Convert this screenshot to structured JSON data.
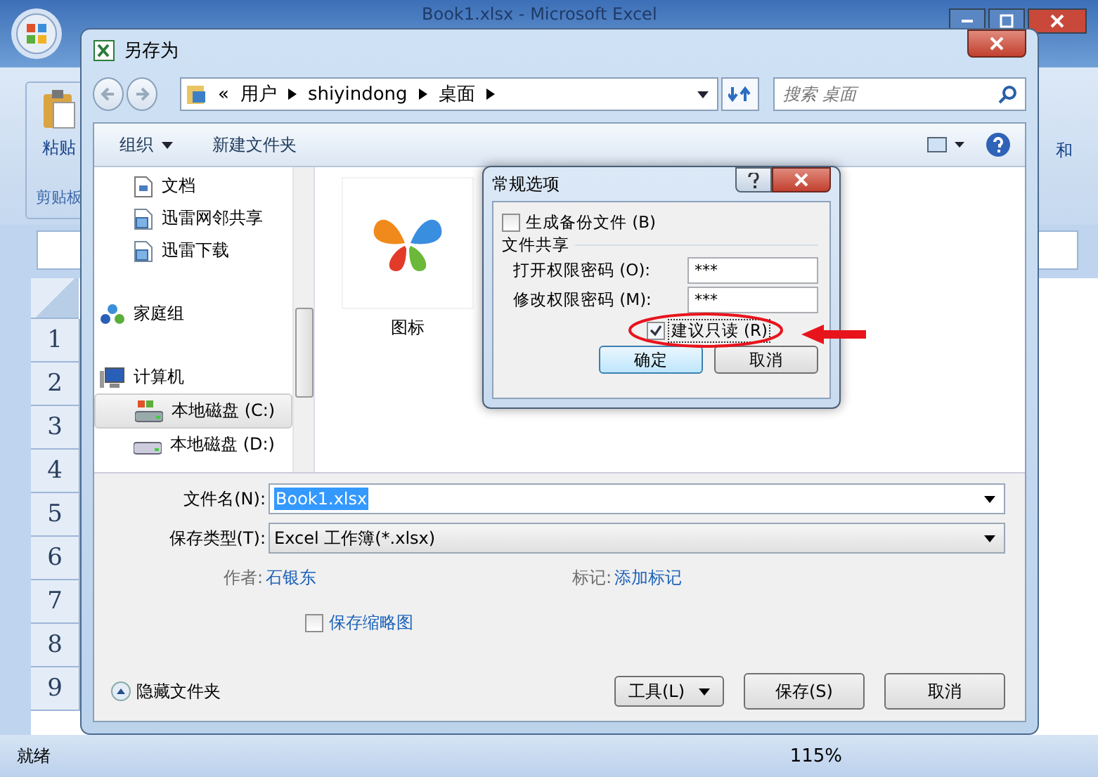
{
  "excel": {
    "title": "Book1.xlsx - Microsoft Excel",
    "paste_button": "粘贴",
    "clipboard_label": "剪贴板",
    "ribbon_cut_label": "和",
    "row_headers": [
      "1",
      "2",
      "3",
      "4",
      "5",
      "6",
      "7",
      "8",
      "9"
    ],
    "status": "就绪",
    "zoom": "115%"
  },
  "save_dialog": {
    "title": "另存为",
    "breadcrumb_prefix": "«",
    "breadcrumb": [
      "用户",
      "shiyindong",
      "桌面"
    ],
    "search": {
      "placeholder": "搜索 桌面"
    },
    "toolbar": [
      "组织",
      "新建文件夹"
    ],
    "nav": [
      {
        "label": "文档",
        "kind": "doc",
        "selected": false
      },
      {
        "label": "迅雷网邻共享",
        "kind": "share",
        "selected": false
      },
      {
        "label": "迅雷下载",
        "kind": "share",
        "selected": false
      },
      {
        "label": "家庭组",
        "kind": "homegroup",
        "selected": false
      },
      {
        "label": "计算机",
        "kind": "computer",
        "selected": false,
        "children": [
          {
            "label": "本地磁盘 (C:)",
            "kind": "sysdisk",
            "selected": true
          },
          {
            "label": "本地磁盘 (D:)",
            "kind": "disk",
            "selected": false
          }
        ]
      }
    ],
    "files": [
      {
        "name": "图标"
      }
    ],
    "filename": {
      "label": "文件名(N):",
      "value": "Book1.xlsx"
    },
    "filetype": {
      "label": "保存类型(T):",
      "value": "Excel 工作簿(*.xlsx)"
    },
    "author": {
      "label": "作者:",
      "value": "石银东"
    },
    "tags": {
      "label": "标记:",
      "value": "添加标记"
    },
    "thumbnail": {
      "label": "保存缩略图",
      "checked": false
    },
    "hide_folders": "隐藏文件夹",
    "buttons": {
      "tools": "工具(L)",
      "save": "保存(S)",
      "cancel": "取消"
    }
  },
  "options_dialog": {
    "title": "常规选项",
    "backup": {
      "label": "生成备份文件 (B)",
      "checked": false
    },
    "group": "文件共享",
    "fields": [
      {
        "label": "打开权限密码 (O):",
        "value": "***"
      },
      {
        "label": "修改权限密码 (M):",
        "value": "***"
      }
    ],
    "read_only": {
      "label": "建议只读 (R)",
      "checked": true
    },
    "buttons": [
      "确定",
      "取消"
    ]
  }
}
